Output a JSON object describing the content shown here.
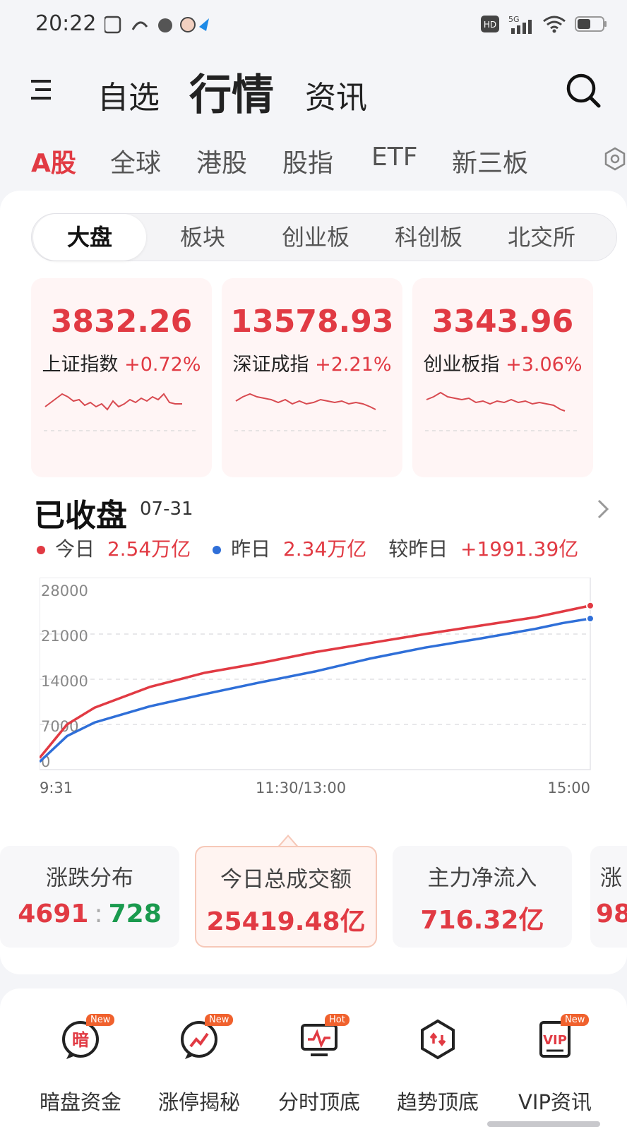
{
  "status_bar": {
    "time": "20:22",
    "network": "5G",
    "hd": "HD"
  },
  "header": {
    "tabs": [
      {
        "label": "自选"
      },
      {
        "label": "行情"
      },
      {
        "label": "资讯"
      }
    ],
    "active_tab": "行情"
  },
  "market_tabs": [
    {
      "label": "A股"
    },
    {
      "label": "全球"
    },
    {
      "label": "港股"
    },
    {
      "label": "股指"
    },
    {
      "label": "ETF"
    },
    {
      "label": "新三板"
    }
  ],
  "segments": [
    {
      "label": "大盘"
    },
    {
      "label": "板块"
    },
    {
      "label": "创业板"
    },
    {
      "label": "科创板"
    },
    {
      "label": "北交所"
    }
  ],
  "indices": [
    {
      "value": "3832.26",
      "name": "上证指数",
      "change": "+0.72%"
    },
    {
      "value": "13578.93",
      "name": "深证成指",
      "change": "+2.21%"
    },
    {
      "value": "3343.96",
      "name": "创业板指",
      "change": "+3.06%"
    }
  ],
  "closing": {
    "title": "已收盘",
    "date": "07-31",
    "today_label": "今日",
    "today_value": "2.54万亿",
    "yesterday_label": "昨日",
    "yesterday_value": "2.34万亿",
    "compare_label": "较昨日",
    "compare_value": "+1991.39亿"
  },
  "chart_data": {
    "type": "line",
    "x_ticks": [
      "9:31",
      "11:30/13:00",
      "15:00"
    ],
    "y_ticks": [
      "28000",
      "21000",
      "14000",
      "7000",
      "0"
    ],
    "ylim": [
      0,
      28000
    ],
    "x": [
      0,
      0.05,
      0.1,
      0.2,
      0.3,
      0.4,
      0.5,
      0.6,
      0.7,
      0.8,
      0.9,
      0.95,
      1.0
    ],
    "series": [
      {
        "color": "#e13a43",
        "values": [
          1800,
          7000,
          9600,
          12800,
          15000,
          16500,
          18200,
          19600,
          21000,
          22300,
          23600,
          24500,
          25400
        ]
      },
      {
        "color": "#2f6fd8",
        "values": [
          1200,
          5200,
          7300,
          9800,
          11700,
          13500,
          15200,
          17200,
          18900,
          20300,
          21800,
          22700,
          23400
        ]
      }
    ],
    "grid": true
  },
  "stats": [
    {
      "title": "涨跌分布",
      "up": "4691",
      "down": "728"
    },
    {
      "title": "今日总成交额",
      "value": "25419.48亿"
    },
    {
      "title": "主力净流入",
      "value": "716.32亿"
    },
    {
      "title": "涨",
      "value": "98"
    }
  ],
  "tools": [
    {
      "label": "暗盘资金",
      "badge": "New",
      "glyph": "暗"
    },
    {
      "label": "涨停揭秘",
      "badge": "New",
      "glyph": ""
    },
    {
      "label": "分时顶底",
      "badge": "Hot",
      "glyph": ""
    },
    {
      "label": "趋势顶底",
      "badge": "",
      "glyph": ""
    },
    {
      "label": "VIP资讯",
      "badge": "New",
      "glyph": "VIP"
    }
  ],
  "colors": {
    "red": "#e13a43",
    "green": "#1a9a4e",
    "blue": "#2f6fd8"
  }
}
